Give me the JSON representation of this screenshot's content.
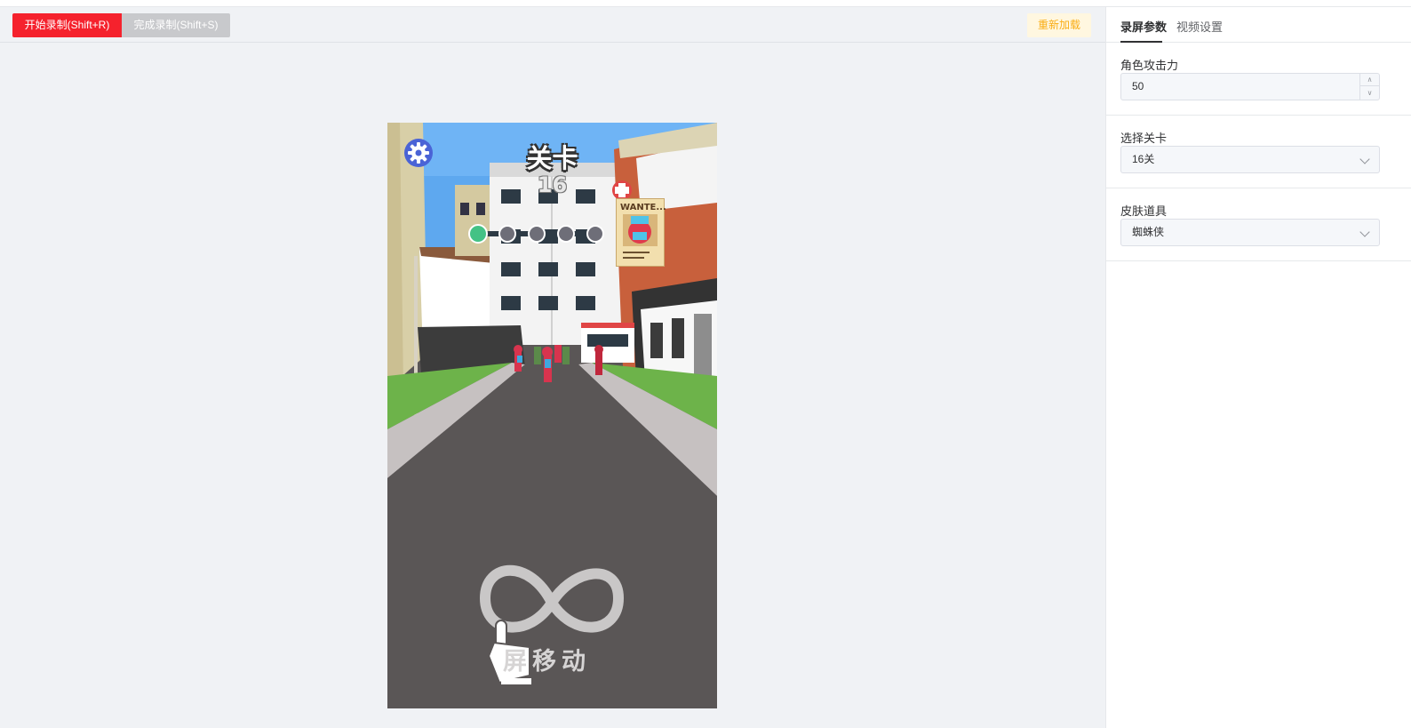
{
  "toolbar": {
    "start_label": "开始录制(Shift+R)",
    "finish_label": "完成录制(Shift+S)",
    "reload_label": "重新加载"
  },
  "game": {
    "title": "关卡",
    "level": "16",
    "wanted_label": "WANTE...",
    "hint": "屏移动",
    "progress_dots": 5,
    "progress_done": 1
  },
  "panel": {
    "tabs": [
      {
        "label": "录屏参数",
        "active": true
      },
      {
        "label": "视频设置",
        "active": false
      }
    ],
    "fields": {
      "attack": {
        "label": "角色攻击力",
        "value": "50"
      },
      "level": {
        "label": "选择关卡",
        "value": "16关"
      },
      "skin": {
        "label": "皮肤道具",
        "value": "蜘蛛侠"
      }
    }
  },
  "colors": {
    "start_button": "#f5222d",
    "finish_button": "#c8c9cc",
    "reload_text": "#faad14",
    "sky": "#5ea8ef",
    "road": "#5a5656",
    "grass": "#6db34a"
  },
  "icons": {
    "settings": "gear-icon",
    "hint": "pointer-hand-icon",
    "gesture": "infinity-icon"
  }
}
